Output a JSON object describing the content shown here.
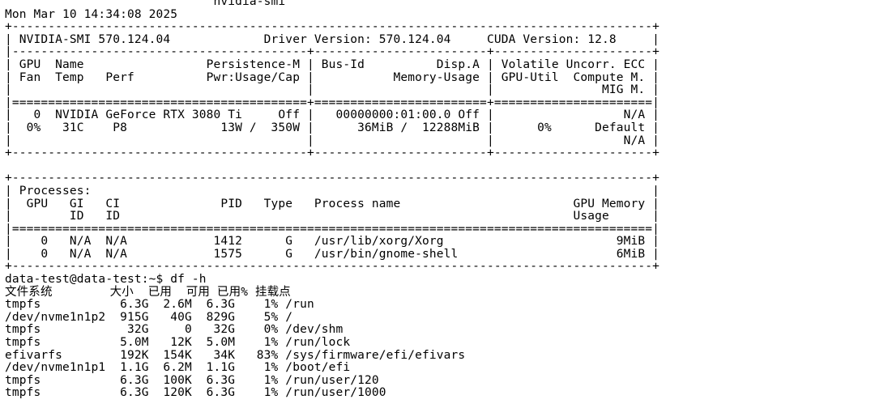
{
  "terminal": {
    "lines": [
      "                             nvidia-smi",
      "Mon Mar 10 14:34:08 2025",
      "+-----------------------------------------------------------------------------------------+",
      "| NVIDIA-SMI 570.124.04             Driver Version: 570.124.04     CUDA Version: 12.8     |",
      "|-----------------------------------------+------------------------+----------------------+",
      "| GPU  Name                 Persistence-M | Bus-Id          Disp.A | Volatile Uncorr. ECC |",
      "| Fan  Temp   Perf          Pwr:Usage/Cap |           Memory-Usage | GPU-Util  Compute M. |",
      "|                                         |                        |               MIG M. |",
      "|=========================================+========================+======================|",
      "|   0  NVIDIA GeForce RTX 3080 Ti     Off |   00000000:01:00.0 Off |                  N/A |",
      "|  0%   31C    P8             13W /  350W |      36MiB /  12288MiB |      0%      Default |",
      "|                                         |                        |                  N/A |",
      "+-----------------------------------------+------------------------+----------------------+",
      "",
      "+-----------------------------------------------------------------------------------------+",
      "| Processes:                                                                              |",
      "|  GPU   GI   CI              PID   Type   Process name                        GPU Memory |",
      "|        ID   ID                                                               Usage      |",
      "|=========================================================================================|",
      "|    0   N/A  N/A            1412      G   /usr/lib/xorg/Xorg                        9MiB |",
      "|    0   N/A  N/A            1575      G   /usr/bin/gnome-shell                      6MiB |",
      "+-----------------------------------------------------------------------------------------+",
      "data-test@data-test:~$ df -h",
      "文件系统        大小  已用  可用 已用% 挂载点",
      "tmpfs           6.3G  2.6M  6.3G    1% /run",
      "/dev/nvme1n1p2  915G   40G  829G    5% /",
      "tmpfs            32G     0   32G    0% /dev/shm",
      "tmpfs           5.0M   12K  5.0M    1% /run/lock",
      "efivarfs        192K  154K   34K   83% /sys/firmware/efi/efivars",
      "/dev/nvme1n1p1  1.1G  6.2M  1.1G    1% /boot/efi",
      "tmpfs           6.3G  100K  6.3G    1% /run/user/120",
      "tmpfs           6.3G  120K  6.3G    1% /run/user/1000"
    ]
  }
}
